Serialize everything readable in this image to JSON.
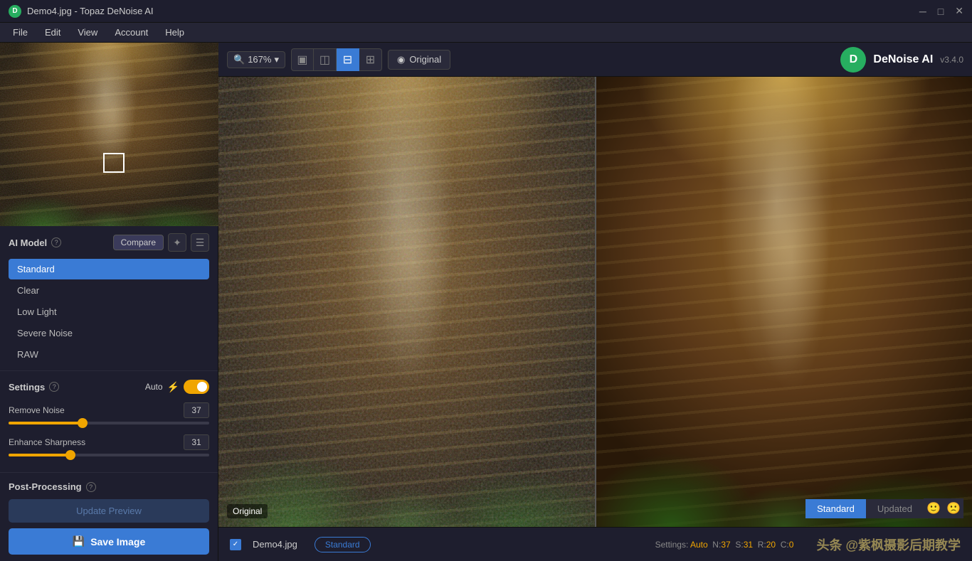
{
  "titlebar": {
    "title": "Demo4.jpg - Topaz DeNoise AI",
    "logo": "D",
    "controls": {
      "minimize": "─",
      "maximize": "□",
      "close": "✕"
    }
  },
  "menubar": {
    "items": [
      "File",
      "Edit",
      "View",
      "Account",
      "Help"
    ]
  },
  "toolbar": {
    "zoom": "167%",
    "view_buttons": [
      {
        "id": "single",
        "icon": "▣"
      },
      {
        "id": "split-h",
        "icon": "◫"
      },
      {
        "id": "split-v",
        "icon": "⊟"
      },
      {
        "id": "grid",
        "icon": "⊞"
      }
    ],
    "original_label": "Original",
    "app_logo": "D",
    "app_title": "DeNoise AI",
    "app_version": "v3.4.0"
  },
  "ai_model": {
    "title": "AI Model",
    "compare_label": "Compare",
    "models": [
      {
        "name": "Standard",
        "active": true
      },
      {
        "name": "Clear",
        "active": false
      },
      {
        "name": "Low Light",
        "active": false
      },
      {
        "name": "Severe Noise",
        "active": false
      },
      {
        "name": "RAW",
        "active": false
      }
    ]
  },
  "settings": {
    "title": "Settings",
    "auto_label": "Auto",
    "auto_enabled": true,
    "remove_noise": {
      "label": "Remove Noise",
      "value": 37,
      "percent": 37
    },
    "enhance_sharpness": {
      "label": "Enhance Sharpness",
      "value": 31,
      "percent": 31
    }
  },
  "post_processing": {
    "title": "Post-Processing",
    "update_preview_label": "Update Preview",
    "save_image_label": "Save Image"
  },
  "canvas": {
    "original_label": "Original"
  },
  "comparison": {
    "standard_label": "Standard",
    "updated_label": "Updated"
  },
  "bottom_bar": {
    "filename": "Demo4.jpg",
    "model_label": "Standard",
    "settings_info": "Settings: Auto  N:37  S:31  R:20  C:0"
  },
  "icons": {
    "help": "?",
    "lightning": "⚡",
    "eye": "◉",
    "save": "💾",
    "zoom_in": "🔍",
    "chevron": "▾",
    "list": "☰",
    "star": "✦",
    "emoji_pos": "🙂",
    "emoji_neg": "🙁",
    "check": "✓"
  }
}
